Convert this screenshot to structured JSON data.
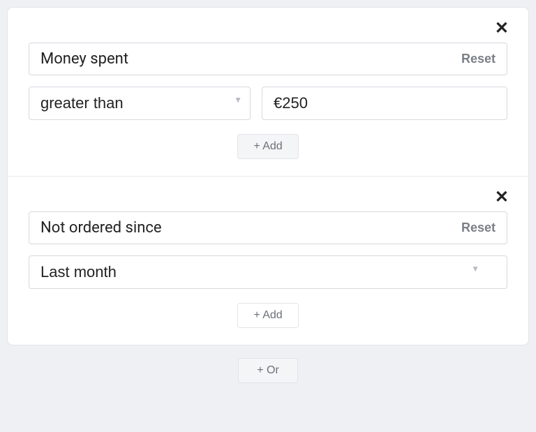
{
  "filters": [
    {
      "field_label": "Money spent",
      "reset_label": "Reset",
      "operator": "greater than",
      "value": "€250",
      "add_label": "+ Add",
      "has_value_input": true
    },
    {
      "field_label": "Not ordered since",
      "reset_label": "Reset",
      "operator": "Last month",
      "value": "",
      "add_label": "+ Add",
      "has_value_input": false
    }
  ],
  "or_label": "+ Or"
}
